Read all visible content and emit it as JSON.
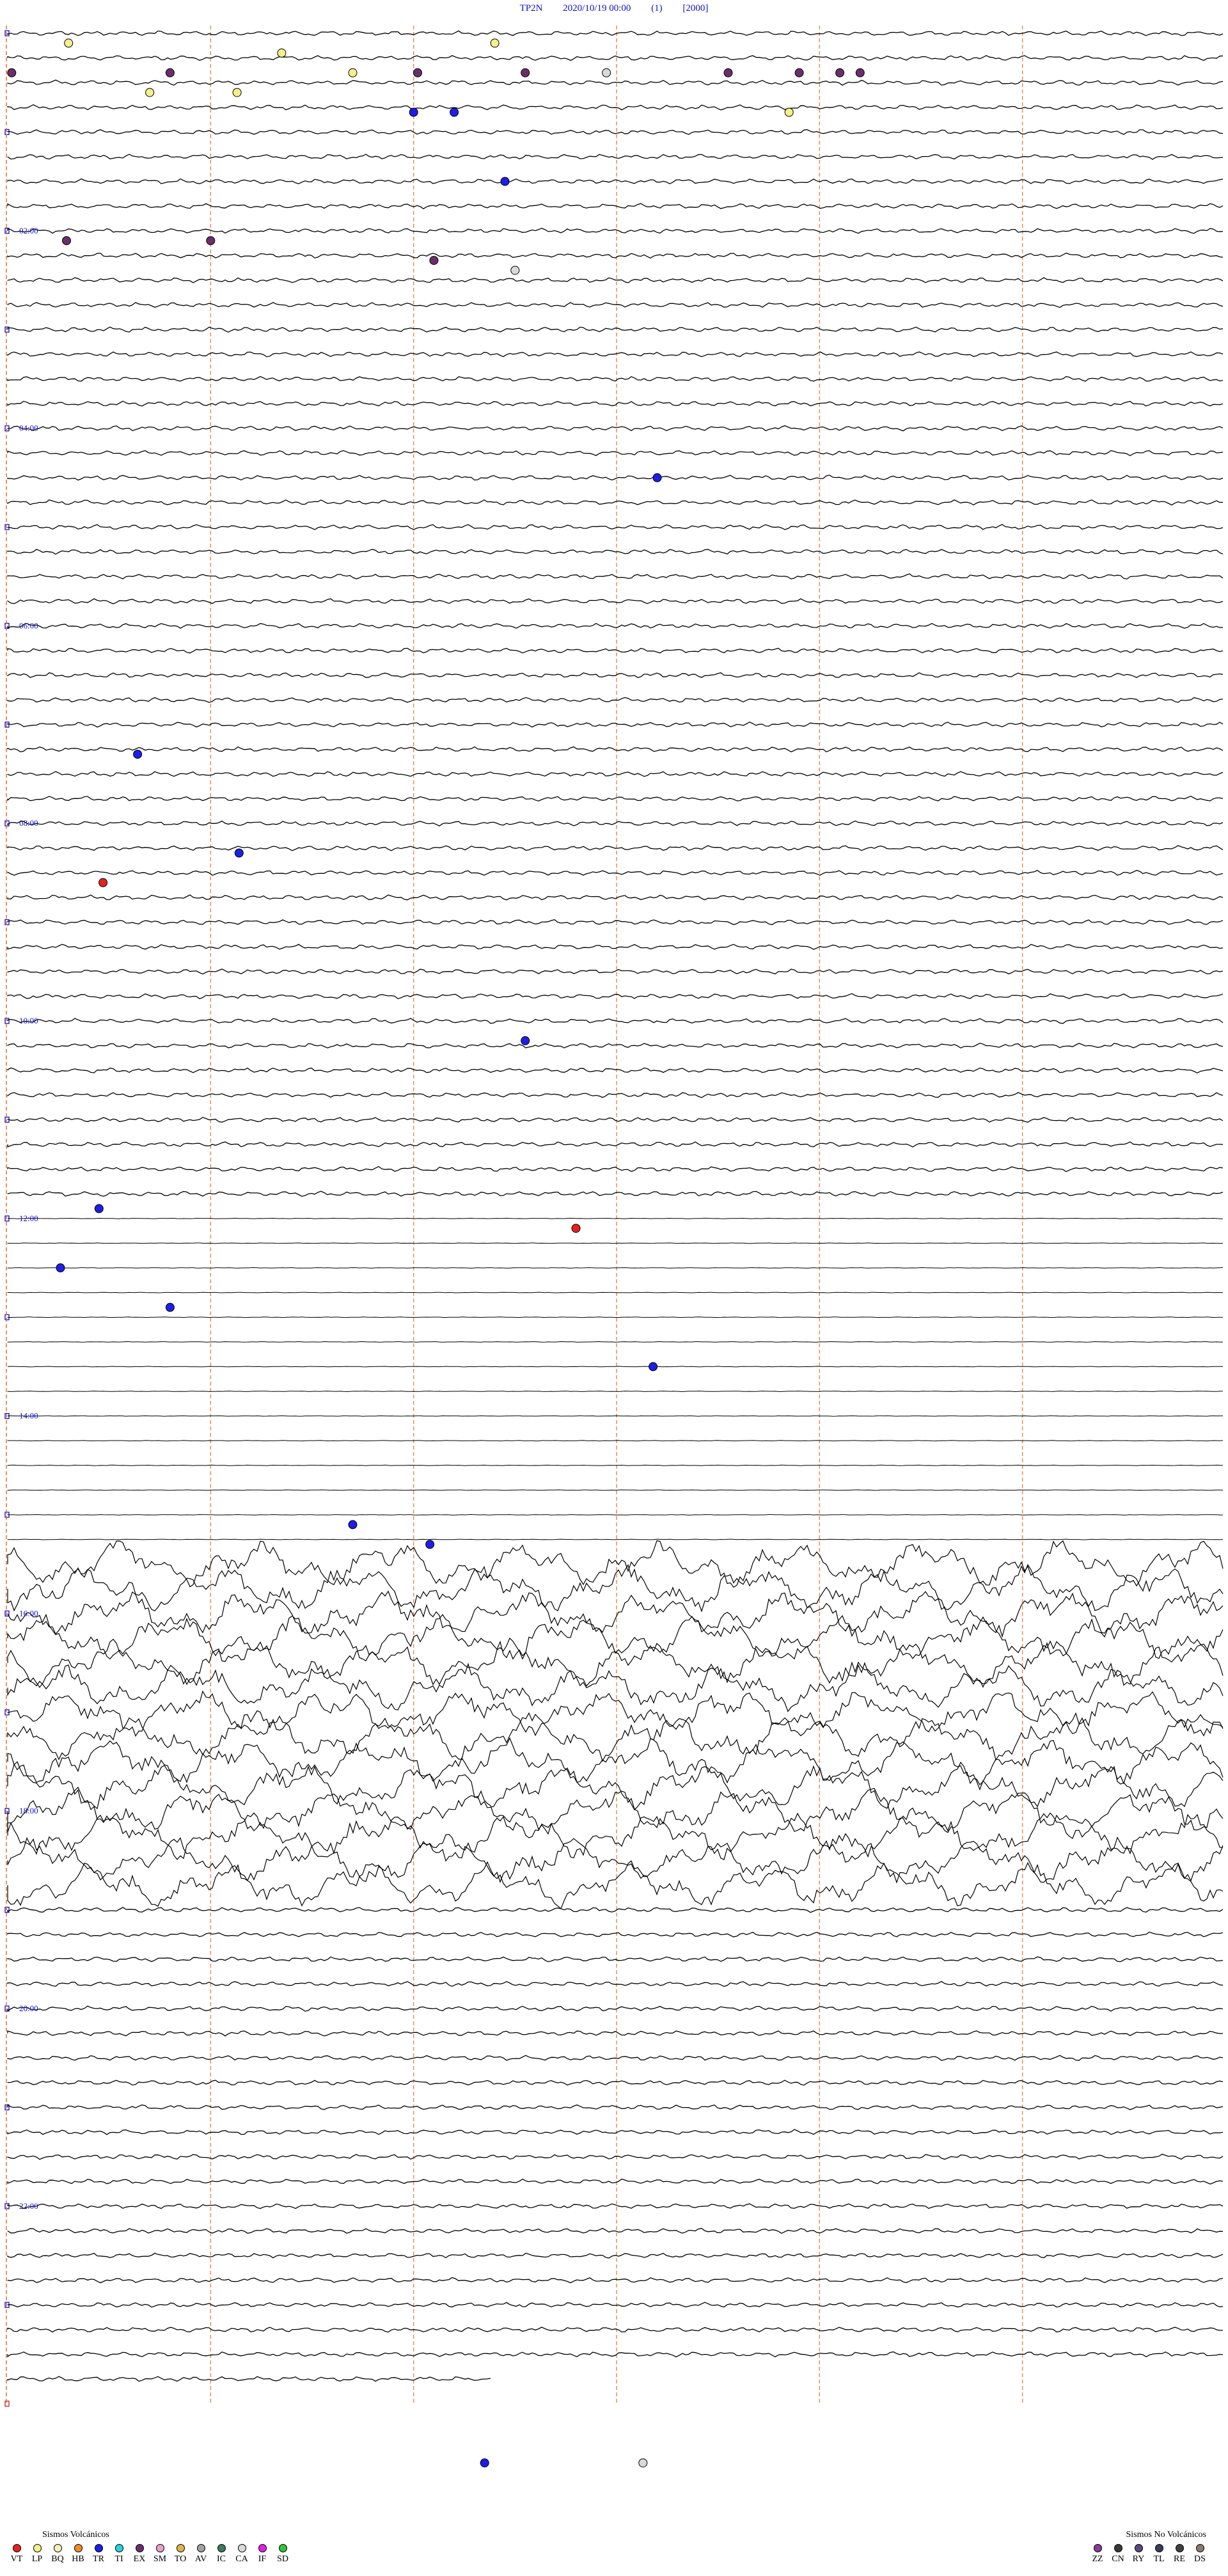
{
  "header": {
    "station": "TP2N",
    "datetime": "2020/10/19 00:00",
    "channel": "(1)",
    "scale": "[2000]"
  },
  "chart_data": {
    "type": "helicorder",
    "title": "TP2N   2020/10/19 00:00   (1)   [2000]",
    "hour_labels": [
      "02:00",
      "04:00",
      "06:00",
      "08:00",
      "10:00",
      "12:00",
      "14:00",
      "16:00",
      "18:00",
      "20:00",
      "22:00"
    ],
    "trace_count": 96,
    "minutes_per_trace": 15,
    "events": [
      {
        "type": "LP",
        "hour": 0.1,
        "min": 3.0
      },
      {
        "type": "LP",
        "hour": 0.2,
        "min": 13.5
      },
      {
        "type": "LP",
        "hour": 0.1,
        "min": 24.0
      },
      {
        "type": "EX",
        "hour": 0.4,
        "min": 0.2
      },
      {
        "type": "EX",
        "hour": 0.4,
        "min": 8.0
      },
      {
        "type": "LP",
        "hour": 0.4,
        "min": 17.0
      },
      {
        "type": "EX",
        "hour": 0.4,
        "min": 20.2
      },
      {
        "type": "EX",
        "hour": 0.4,
        "min": 25.5
      },
      {
        "type": "CA",
        "hour": 0.4,
        "min": 29.5
      },
      {
        "type": "EX",
        "hour": 0.4,
        "min": 35.5
      },
      {
        "type": "EX",
        "hour": 0.4,
        "min": 39.0
      },
      {
        "type": "EX",
        "hour": 0.4,
        "min": 41.0
      },
      {
        "type": "EX",
        "hour": 0.4,
        "min": 42.0
      },
      {
        "type": "LP",
        "hour": 0.6,
        "min": 7.0
      },
      {
        "type": "LP",
        "hour": 0.6,
        "min": 11.3
      },
      {
        "type": "TR",
        "hour": 0.8,
        "min": 20.0
      },
      {
        "type": "TR",
        "hour": 0.8,
        "min": 22.0
      },
      {
        "type": "LP",
        "hour": 0.8,
        "min": 38.5
      },
      {
        "type": "TR",
        "hour": 1.5,
        "min": 24.5
      },
      {
        "type": "EX",
        "hour": 2.1,
        "min": 2.9
      },
      {
        "type": "EX",
        "hour": 2.1,
        "min": 10.0
      },
      {
        "type": "EX",
        "hour": 2.3,
        "min": 21.0
      },
      {
        "type": "CA",
        "hour": 2.4,
        "min": 25.0
      },
      {
        "type": "TR",
        "hour": 4.5,
        "min": 32.0
      },
      {
        "type": "TR",
        "hour": 7.3,
        "min": 6.4
      },
      {
        "type": "TR",
        "hour": 8.3,
        "min": 11.4
      },
      {
        "type": "VT",
        "hour": 8.6,
        "min": 4.7
      },
      {
        "type": "TR",
        "hour": 10.2,
        "min": 25.5
      },
      {
        "type": "TR",
        "hour": 11.9,
        "min": 4.5
      },
      {
        "type": "VT",
        "hour": 12.1,
        "min": 28.0
      },
      {
        "type": "TR",
        "hour": 12.5,
        "min": 2.6
      },
      {
        "type": "TR",
        "hour": 12.9,
        "min": 8.0
      },
      {
        "type": "TR",
        "hour": 13.5,
        "min": 31.8
      },
      {
        "type": "TR",
        "hour": 15.1,
        "min": 17.0
      },
      {
        "type": "TR",
        "hour": 15.3,
        "min": 20.8
      },
      {
        "type": "TR",
        "hour": 24.6,
        "min": 23.5
      },
      {
        "type": "CA",
        "hour": 24.6,
        "min": 31.3
      }
    ]
  },
  "legend": {
    "volcanic_title": "Sismos Volcánicos",
    "volcanic": [
      {
        "code": "VT",
        "color": "#e8211e"
      },
      {
        "code": "LP",
        "color": "#f3f08a"
      },
      {
        "code": "BQ",
        "color": "#f5f0b8"
      },
      {
        "code": "HB",
        "color": "#f08a2a"
      },
      {
        "code": "TR",
        "color": "#1e1ee8"
      },
      {
        "code": "TI",
        "color": "#21d6de"
      },
      {
        "code": "EX",
        "color": "#6b2e6b"
      },
      {
        "code": "SM",
        "color": "#e6a0d2"
      },
      {
        "code": "TO",
        "color": "#e0b34a"
      },
      {
        "code": "AV",
        "color": "#a0a0a0"
      },
      {
        "code": "IC",
        "color": "#3d7a5a"
      },
      {
        "code": "CA",
        "color": "#d9d9d9"
      },
      {
        "code": "IF",
        "color": "#e020e0"
      },
      {
        "code": "SD",
        "color": "#2ec43a"
      }
    ],
    "non_volcanic_title": "Sismos No Volcánicos",
    "non_volcanic": [
      {
        "code": "ZZ",
        "color": "#8a3a9a"
      },
      {
        "code": "CN",
        "color": "#3a3a3a"
      },
      {
        "code": "RY",
        "color": "#5a4a7a"
      },
      {
        "code": "TL",
        "color": "#3a3a5a"
      },
      {
        "code": "RE",
        "color": "#404040"
      },
      {
        "code": "DS",
        "color": "#8a7a6a"
      }
    ]
  }
}
